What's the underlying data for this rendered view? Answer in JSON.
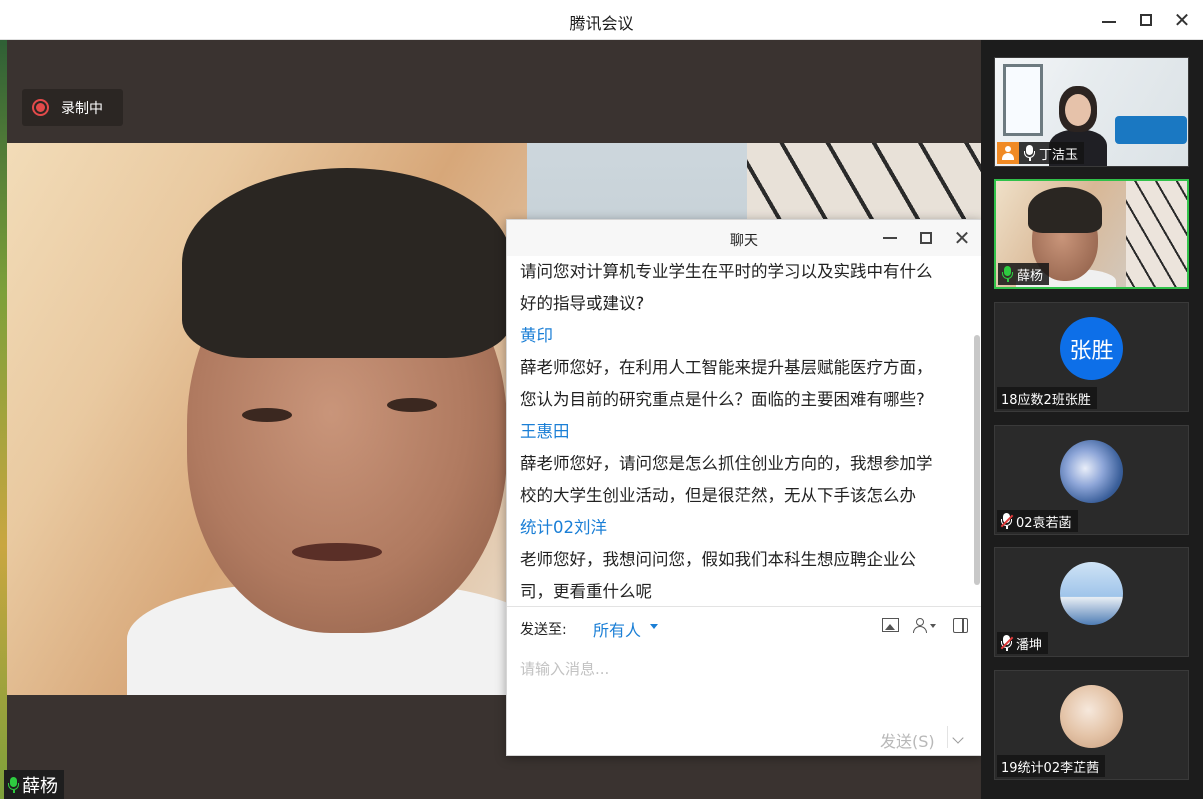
{
  "window": {
    "title": "腾讯会议",
    "minimize_icon": "minimize-icon",
    "maximize_icon": "maximize-icon",
    "close_icon": "close-icon"
  },
  "recording": {
    "label": "录制中",
    "color": "#e34a4a"
  },
  "main_speaker": {
    "name": "薛杨"
  },
  "chat": {
    "title": "聊天",
    "messages": [
      {
        "lines": [
          "请问您对计算机专业学生在平时的学习以及实践中有什么",
          "好的指导或建议?"
        ]
      },
      {
        "sender": "黄印",
        "lines": [
          "薛老师您好，在利用人工智能来提升基层赋能医疗方面，",
          "您认为目前的研究重点是什么？面临的主要困难有哪些?"
        ]
      },
      {
        "sender": "王惠田",
        "lines": [
          "薛老师您好，请问您是怎么抓住创业方向的，我想参加学",
          "校的大学生创业活动，但是很茫然，无从下手该怎么办"
        ]
      },
      {
        "sender": "统计02刘洋",
        "lines": [
          "老师您好，我想问问您，假如我们本科生想应聘企业公",
          "司，更看重什么呢"
        ]
      }
    ],
    "send_to_label": "发送至:",
    "send_to_value": "所有人",
    "input_placeholder": "请输入消息...",
    "input_value": "",
    "send_label": "发送(S)",
    "sender_color": "#1b7fd6"
  },
  "participants": [
    {
      "name": "丁洁玉",
      "mic": "on",
      "host": true,
      "video": "camera"
    },
    {
      "name": "薛杨",
      "mic": "on",
      "host": false,
      "video": "camera",
      "active_speaker": true
    },
    {
      "name": "18应数2班张胜",
      "avatar_text": "张胜",
      "mic": "none",
      "video": "avatar"
    },
    {
      "name": "02袁若菡",
      "mic": "muted",
      "video": "avatar"
    },
    {
      "name": "潘坤",
      "mic": "muted",
      "video": "avatar"
    },
    {
      "name": "19统计02李芷茜",
      "mic": "none",
      "video": "avatar"
    }
  ],
  "colors": {
    "speaking_green": "#31c14a",
    "accent_blue": "#0d6fe8"
  }
}
